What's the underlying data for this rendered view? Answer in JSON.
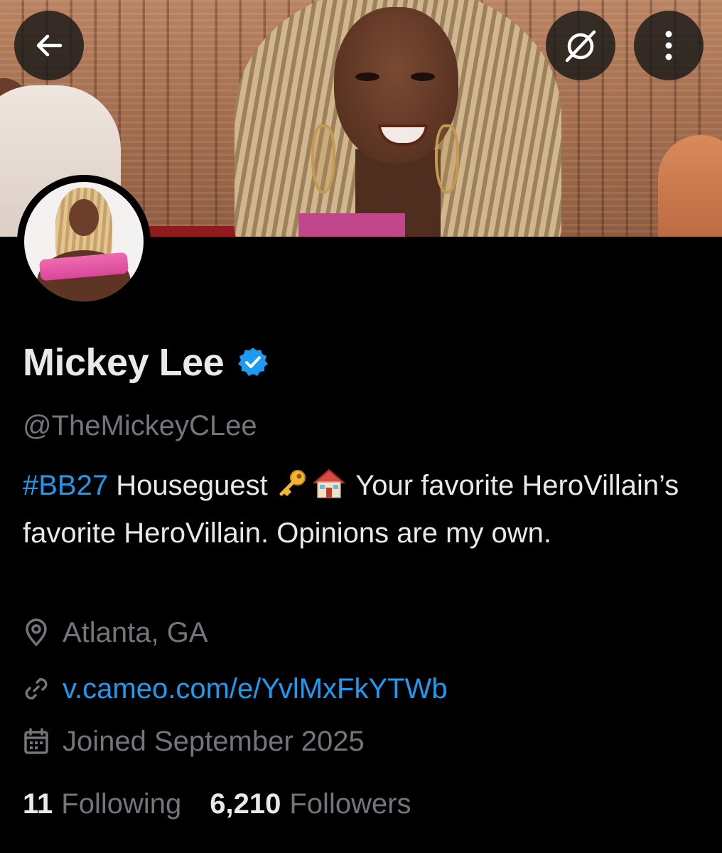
{
  "profile": {
    "display_name": "Mickey Lee",
    "verified": true,
    "handle": "@TheMickeyCLee",
    "bio": {
      "hashtag": "#BB27",
      "text_1": " Houseguest ",
      "emojis": [
        "key",
        "house"
      ],
      "text_2": " Your favorite HeroVillain’s favorite HeroVillain. Opinions are my own."
    },
    "location": "Atlanta, GA",
    "website": "v.cameo.com/e/YvlMxFkYTWb",
    "joined": "Joined September 2025",
    "following_count": "11",
    "following_label": "Following",
    "followers_count": "6,210",
    "followers_label": "Followers"
  },
  "icons": {
    "back": "arrow-left-icon",
    "grok": "grok-slash-icon",
    "more": "more-vertical-icon",
    "verified": "verified-badge-icon",
    "location": "location-pin-icon",
    "link": "link-icon",
    "calendar": "calendar-icon"
  },
  "colors": {
    "background": "#000000",
    "text_primary": "#e7e9ea",
    "text_secondary": "#71767b",
    "accent": "#1d9bf0"
  }
}
